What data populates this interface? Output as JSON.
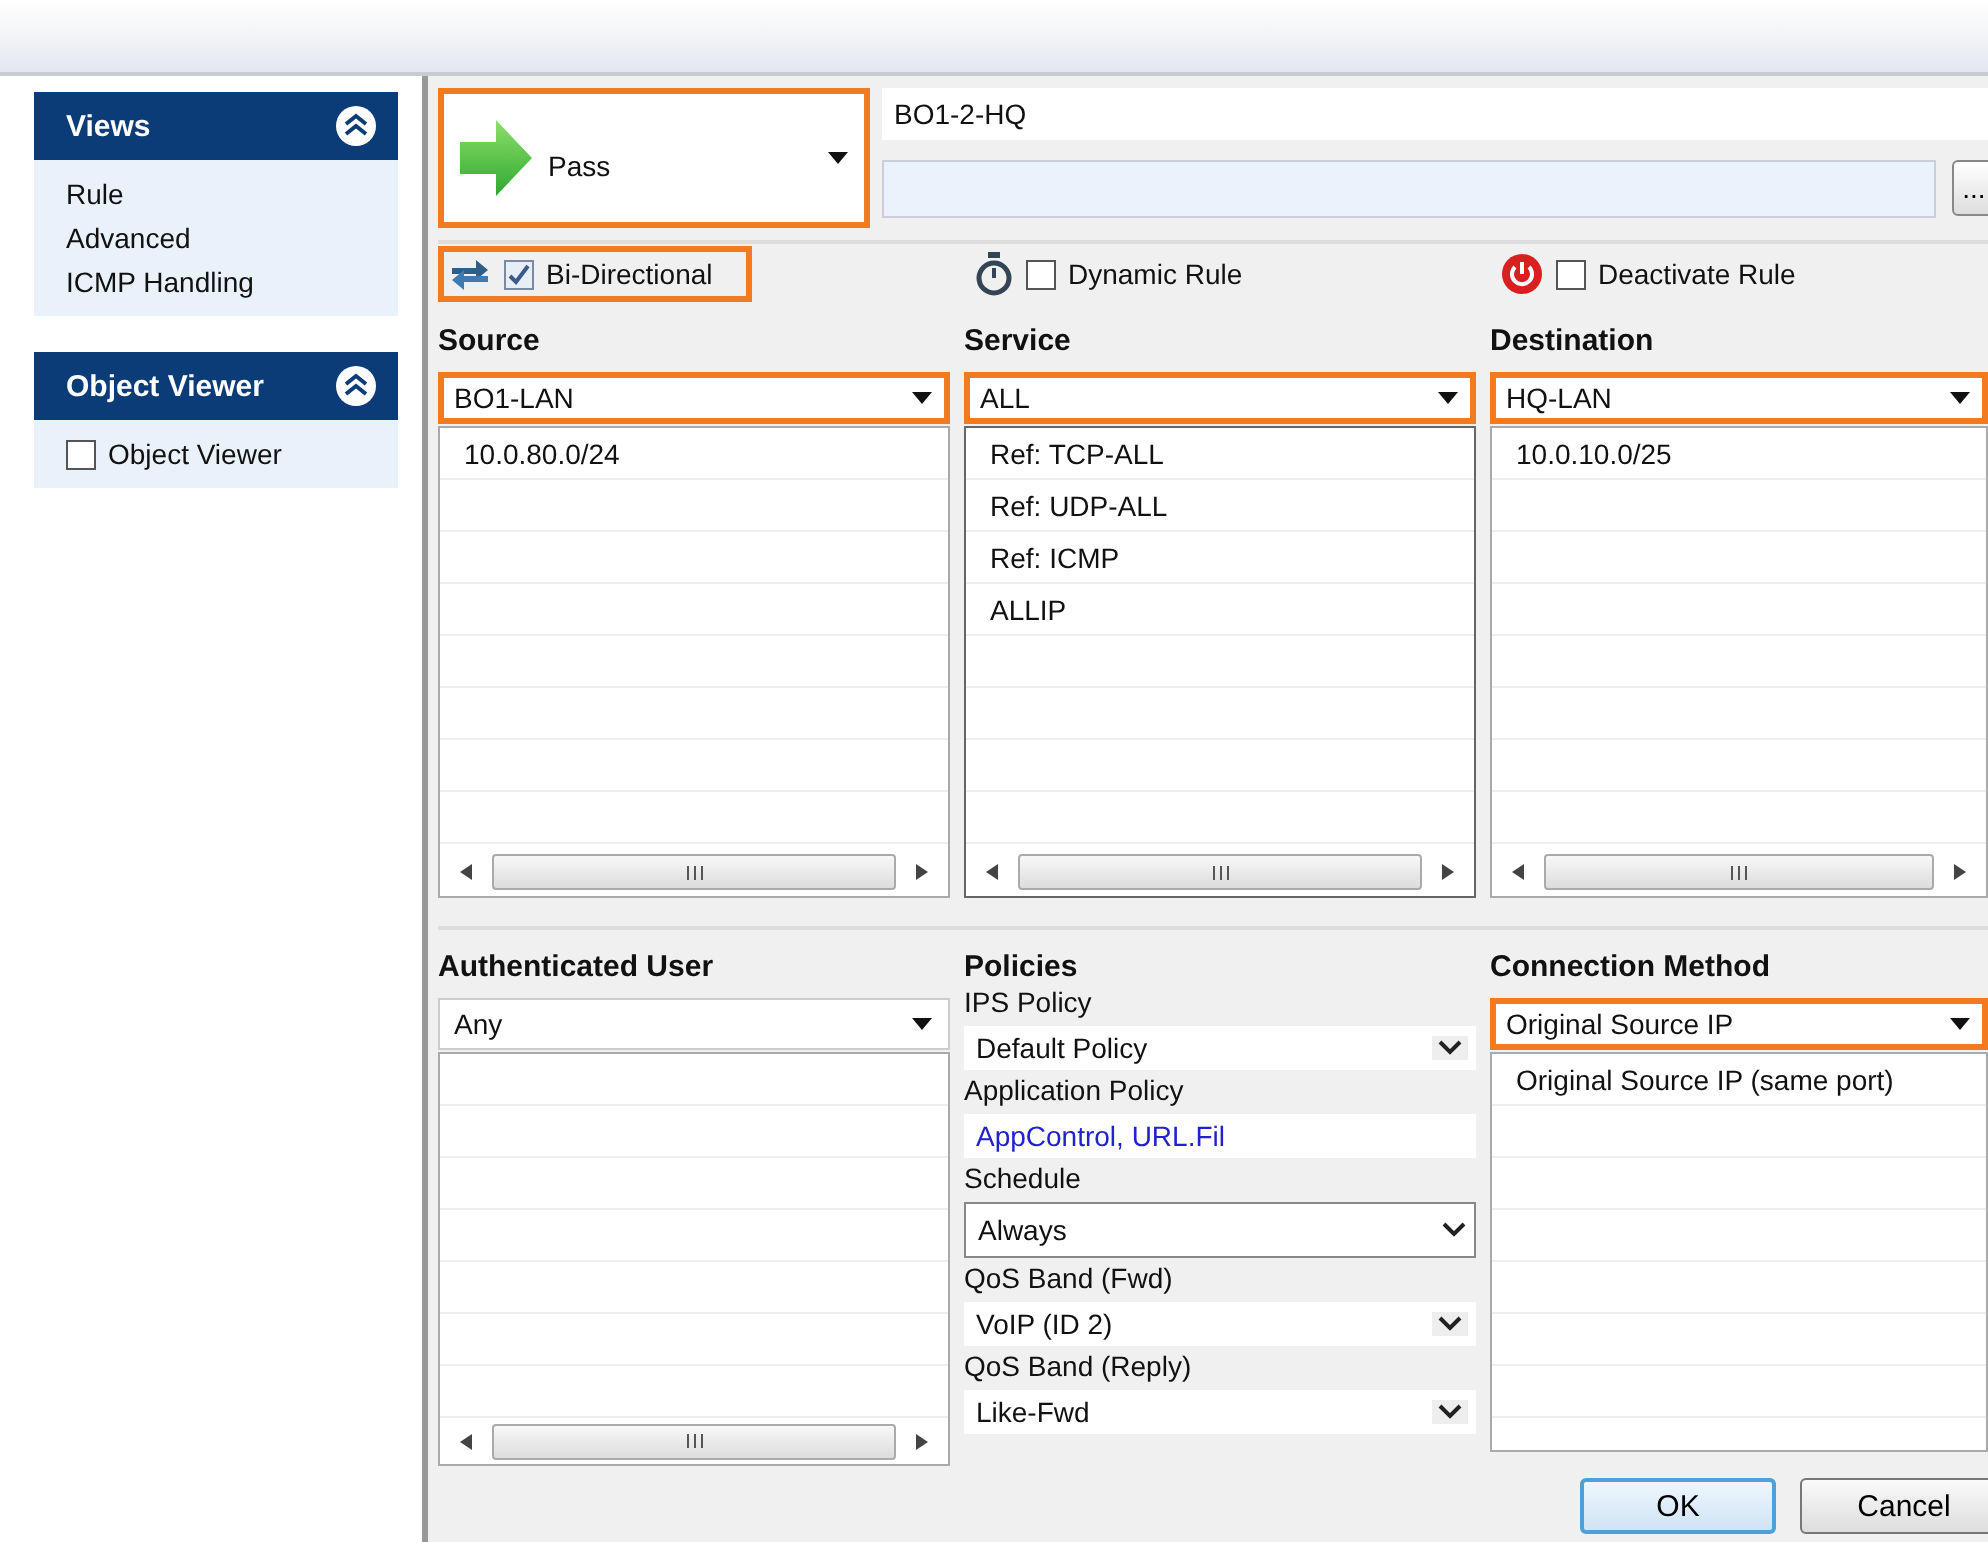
{
  "sidebar": {
    "panels": [
      {
        "title": "Views",
        "items": [
          {
            "kind": "link",
            "label": "Rule"
          },
          {
            "kind": "link",
            "label": "Advanced"
          },
          {
            "kind": "link",
            "label": "ICMP Handling"
          }
        ]
      },
      {
        "title": "Object Viewer",
        "items": [
          {
            "kind": "checkbox",
            "label": "Object Viewer",
            "checked": false
          }
        ]
      }
    ]
  },
  "action": {
    "label": "Pass",
    "highlighted": true
  },
  "rule_name": {
    "value": "BO1-2-HQ"
  },
  "description": {
    "button": "..."
  },
  "options": [
    {
      "kind": "bidirectional",
      "label": "Bi-Directional",
      "checked": true,
      "highlighted": true
    },
    {
      "kind": "dynamic",
      "label": "Dynamic Rule",
      "checked": false,
      "highlighted": false
    },
    {
      "kind": "deactivate",
      "label": "Deactivate Rule",
      "checked": false,
      "highlighted": false
    }
  ],
  "columns": [
    {
      "title": "Source",
      "selection": "BO1-LAN",
      "highlighted": true,
      "boxed": false,
      "entries": [
        "10.0.80.0/24"
      ]
    },
    {
      "title": "Service",
      "selection": "ALL",
      "highlighted": true,
      "boxed": true,
      "entries": [
        "Ref: TCP-ALL",
        "Ref: UDP-ALL",
        "Ref: ICMP",
        "ALLIP"
      ]
    },
    {
      "title": "Destination",
      "selection": "HQ-LAN",
      "highlighted": true,
      "boxed": false,
      "entries": [
        "10.0.10.0/25"
      ]
    }
  ],
  "authenticated_user": {
    "title": "Authenticated User",
    "selection": "Any",
    "highlighted": false
  },
  "policies": {
    "title": "Policies",
    "fields": [
      {
        "kind": "select",
        "label": "IPS Policy",
        "value": "Default Policy"
      },
      {
        "kind": "link",
        "label": "Application Policy",
        "value": "AppControl, URL.Fil"
      },
      {
        "kind": "boxed-select",
        "label": "Schedule",
        "value": "Always"
      },
      {
        "kind": "select",
        "label": "QoS Band (Fwd)",
        "value": "VoIP (ID 2)"
      },
      {
        "kind": "select",
        "label": "QoS Band (Reply)",
        "value": "Like-Fwd"
      }
    ]
  },
  "connection_method": {
    "title": "Connection Method",
    "selection": "Original Source IP",
    "highlighted": true,
    "entries": [
      "Original Source IP (same port)"
    ]
  },
  "buttons": [
    {
      "label": "OK",
      "default": true
    },
    {
      "label": "Cancel",
      "default": false
    }
  ]
}
